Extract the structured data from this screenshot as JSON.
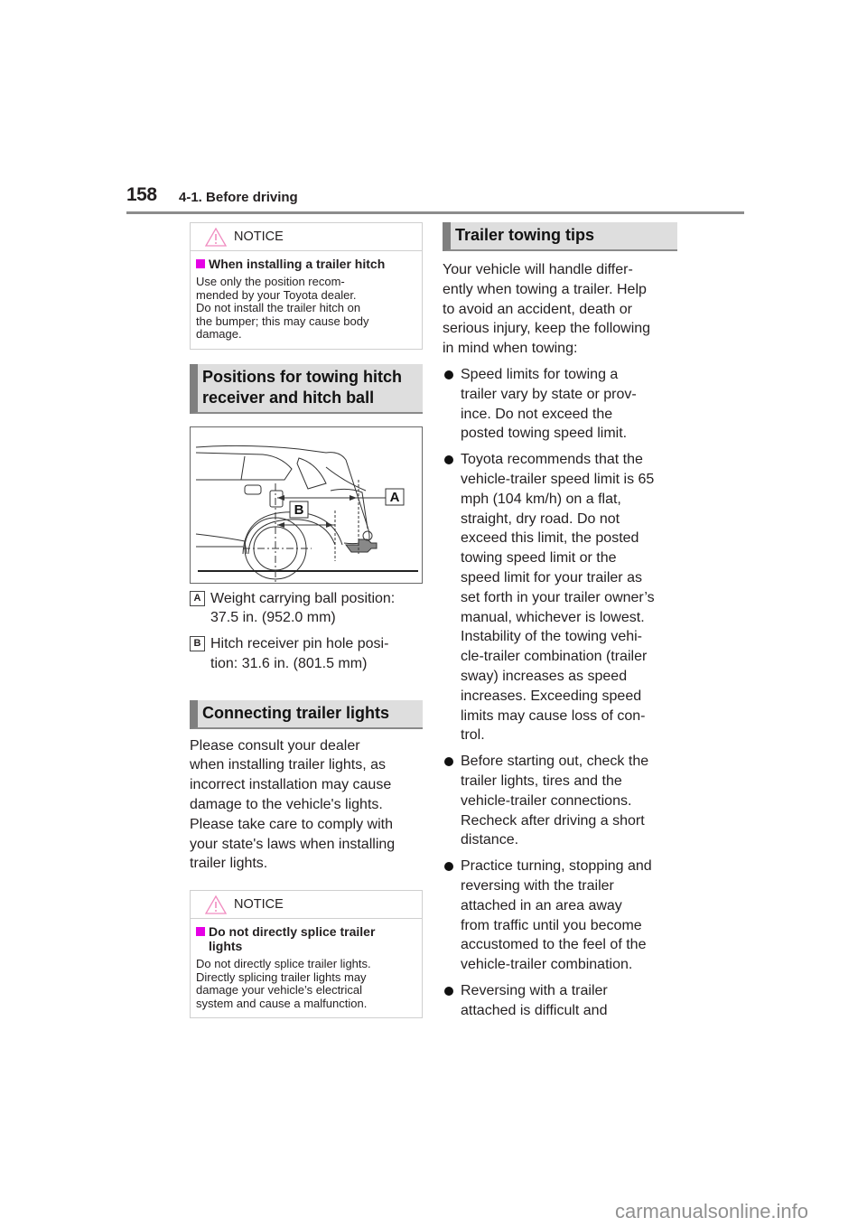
{
  "header": {
    "page_number": "158",
    "section": "4-1. Before driving"
  },
  "notice1": {
    "title": "NOTICE",
    "icon": "warning-triangle-icon",
    "subheading": "When installing a trailer hitch",
    "lines": [
      "Use only the position recom-",
      "mended by your Toyota dealer.",
      "Do not install the trailer hitch on",
      "the bumper; this may cause body",
      "damage."
    ]
  },
  "positions": {
    "heading_lines": [
      "Positions for towing hitch",
      "receiver and hitch ball"
    ],
    "figure_labels": {
      "a": "A",
      "b": "B"
    },
    "legend": [
      {
        "key": "A",
        "lines": [
          "Weight carrying ball position:",
          "37.5 in. (952.0 mm)"
        ]
      },
      {
        "key": "B",
        "lines": [
          "Hitch receiver pin hole posi-",
          "tion: 31.6 in. (801.5 mm)"
        ]
      }
    ]
  },
  "lights": {
    "heading": "Connecting trailer lights",
    "lines": [
      "Please consult your dealer",
      "when installing trailer lights, as",
      "incorrect installation may cause",
      "damage to the vehicle's lights.",
      "Please take care to comply with",
      "your state's laws when installing",
      "trailer lights."
    ]
  },
  "notice2": {
    "title": "NOTICE",
    "icon": "warning-triangle-icon",
    "subheading_lines": [
      "Do not directly splice trailer",
      "lights"
    ],
    "lines": [
      "Do not directly splice trailer lights.",
      "Directly splicing trailer lights may",
      "damage your vehicle’s electrical",
      "system and cause a malfunction."
    ]
  },
  "tips": {
    "heading": "Trailer towing tips",
    "intro_lines": [
      "Your vehicle will handle differ-",
      "ently when towing a trailer. Help",
      "to avoid an accident, death or",
      "serious injury, keep the following",
      "in mind when towing:"
    ],
    "bullets": [
      {
        "lines": [
          "Speed limits for towing a",
          "trailer vary by state or prov-",
          "ince. Do not exceed the",
          "posted towing speed limit."
        ]
      },
      {
        "lines": [
          "Toyota recommends that the",
          "vehicle-trailer speed limit is 65",
          "mph (104 km/h) on a flat,",
          "straight, dry road. Do not",
          "exceed this limit, the posted",
          "towing speed limit or the",
          "speed limit for your trailer as",
          "set forth in your trailer owner’s",
          "manual, whichever is lowest.",
          "Instability of the towing vehi-",
          "cle-trailer combination (trailer",
          "sway) increases as speed",
          "increases. Exceeding speed",
          "limits may cause loss of con-",
          "trol."
        ]
      },
      {
        "lines": [
          "Before starting out, check the",
          "trailer lights, tires and the",
          "vehicle-trailer connections.",
          "Recheck after driving a short",
          "distance."
        ]
      },
      {
        "lines": [
          "Practice turning, stopping and",
          "reversing with the trailer",
          "attached in an area away",
          "from traffic until you become",
          "accustomed to the feel of the",
          "vehicle-trailer combination."
        ]
      },
      {
        "lines": [
          "Reversing with a trailer",
          "attached is difficult and"
        ]
      }
    ]
  },
  "watermark": "carmanualsonline.info",
  "colors": {
    "notice_accent": "#e500e5",
    "warning_icon": "#f08cc0",
    "heading_bg": "#dedede",
    "heading_bar": "#7f7f7f"
  }
}
